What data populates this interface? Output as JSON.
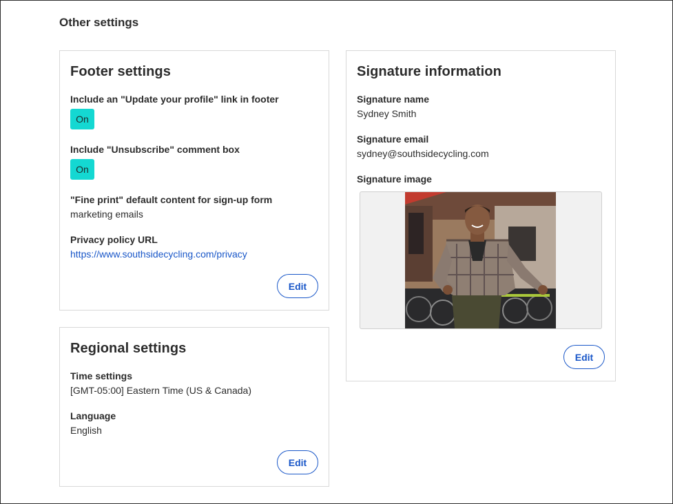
{
  "page": {
    "title": "Other settings"
  },
  "footer_settings": {
    "title": "Footer settings",
    "update_profile_label": "Include an \"Update your profile\" link in footer",
    "update_profile_state": "On",
    "unsubscribe_label": "Include \"Unsubscribe\" comment box",
    "unsubscribe_state": "On",
    "fine_print_label": "\"Fine print\" default content for sign-up form",
    "fine_print_value": "marketing emails",
    "privacy_label": "Privacy policy URL",
    "privacy_url": "https://www.southsidecycling.com/privacy",
    "edit_label": "Edit"
  },
  "regional_settings": {
    "title": "Regional settings",
    "time_label": "Time settings",
    "time_value": "[GMT-05:00] Eastern Time (US & Canada)",
    "language_label": "Language",
    "language_value": "English",
    "edit_label": "Edit"
  },
  "signature_information": {
    "title": "Signature information",
    "name_label": "Signature name",
    "name_value": "Sydney Smith",
    "email_label": "Signature email",
    "email_value": "sydney@southsidecycling.com",
    "image_label": "Signature image",
    "edit_label": "Edit"
  },
  "colors": {
    "toggle_on": "#14d8d2",
    "link": "#1856c8",
    "text": "#2b2b2b",
    "card_border": "#d8d8d8"
  }
}
